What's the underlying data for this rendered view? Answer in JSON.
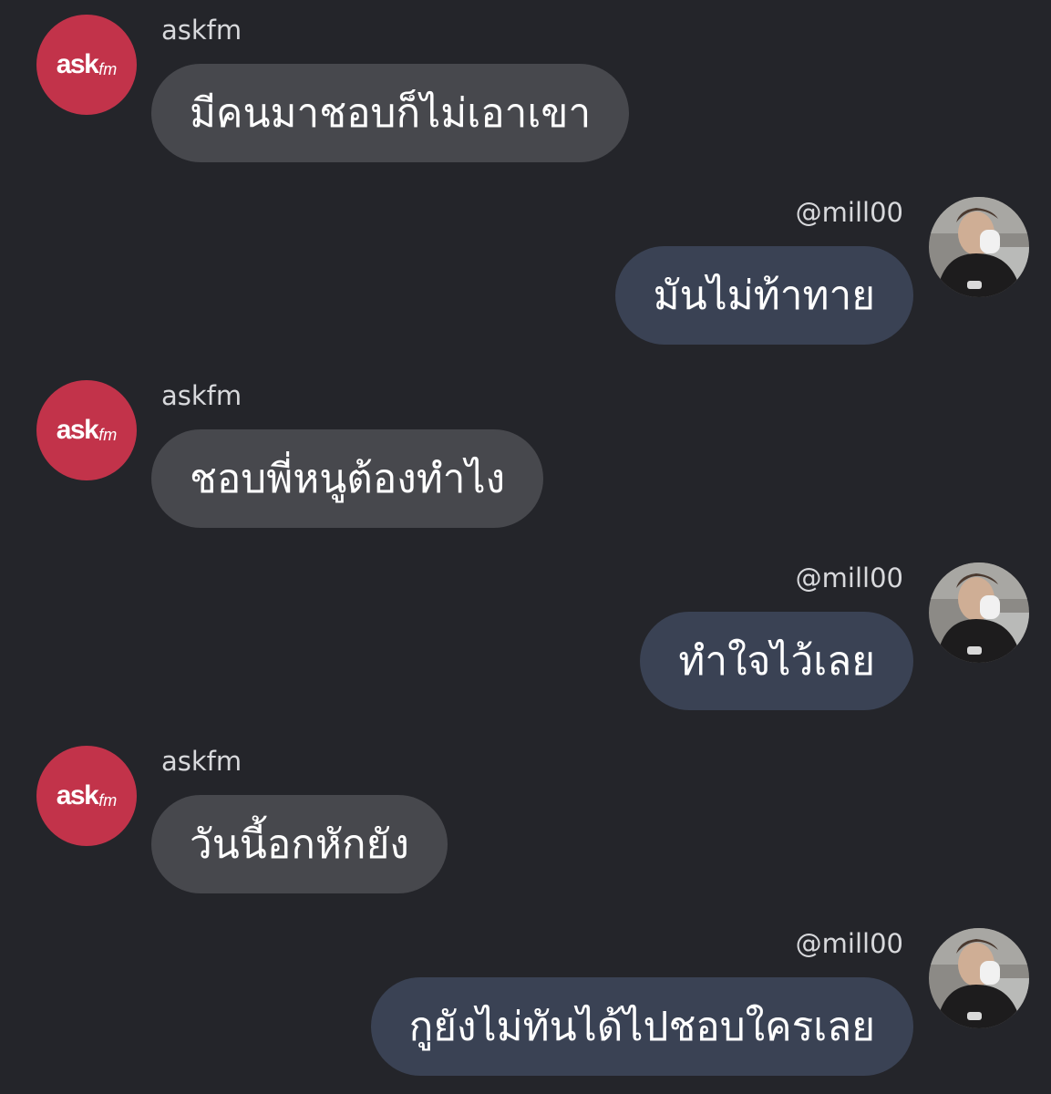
{
  "colors": {
    "background": "#24252a",
    "left_bubble": "#47484d",
    "right_bubble": "#3a4254",
    "askfm_brand": "#c2334a"
  },
  "askfm_logo": {
    "main": "ask",
    "suffix": "fm"
  },
  "messages": [
    {
      "side": "left",
      "sender": "askfm",
      "text": "มีคนมาชอบก็ไม่เอาเขา",
      "avatar": "askfm-logo-icon"
    },
    {
      "side": "right",
      "sender": "@mill00",
      "text": "มันไม่ท้าทาย",
      "avatar": "user-photo-avatar"
    },
    {
      "side": "left",
      "sender": "askfm",
      "text": "ชอบพี่หนูต้องทำไง",
      "avatar": "askfm-logo-icon"
    },
    {
      "side": "right",
      "sender": "@mill00",
      "text": "ทำใจไว้เลย",
      "avatar": "user-photo-avatar"
    },
    {
      "side": "left",
      "sender": "askfm",
      "text": "วันนี้อกหักยัง",
      "avatar": "askfm-logo-icon"
    },
    {
      "side": "right",
      "sender": "@mill00",
      "text": "กูยังไม่ทันได้ไปชอบใครเลย",
      "avatar": "user-photo-avatar"
    }
  ]
}
